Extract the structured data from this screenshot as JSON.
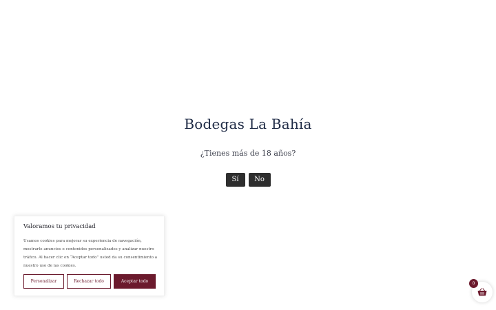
{
  "age_gate": {
    "title": "Bodegas La Bahía",
    "question": "¿Tienes más de 18 años?",
    "yes_label": "Sí",
    "no_label": "No"
  },
  "cookie_banner": {
    "title": "Valoramos tu privacidad",
    "text": "Usamos cookies para mejorar su experiencia de navegación, mostrarle anuncios o contenidos personalizados y analizar nuestro tráfico. Al hacer clic en “Aceptar todo” usted da su consentimiento a nuestro uso de las cookies.",
    "customize_label": "Personalizar",
    "reject_label": "Rechazar todo",
    "accept_label": "Aceptar todo"
  },
  "cart": {
    "count": "0",
    "icon": "basket-icon"
  },
  "colors": {
    "brand": "#6b1a2d",
    "age_button": "#2e2e2e",
    "title_text": "#1e2a45"
  }
}
